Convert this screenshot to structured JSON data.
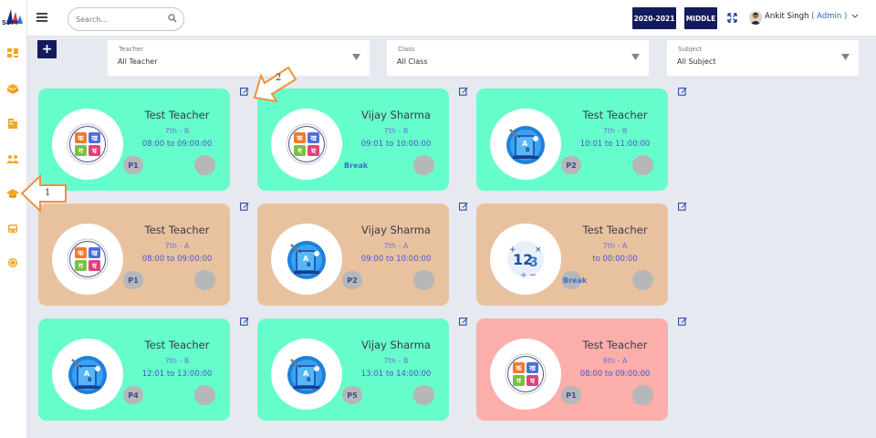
{
  "logo": {
    "text": "SSM"
  },
  "sidebar": {
    "items": [
      {
        "icon": "dashboard-icon",
        "color": "#f5a623"
      },
      {
        "icon": "box-icon",
        "color": "#f5a623"
      },
      {
        "icon": "building-icon",
        "color": "#f5a623"
      },
      {
        "icon": "users-icon",
        "color": "#f5a623"
      },
      {
        "icon": "graduation-cap-icon",
        "color": "#f5a623"
      },
      {
        "icon": "bus-icon",
        "color": "#f5a623"
      },
      {
        "icon": "coin-icon",
        "color": "#f5a623"
      }
    ]
  },
  "header": {
    "search_placeholder": "Search...",
    "session": "2020-2021",
    "level": "MIDDLE",
    "user_name": "Ankit Singh",
    "user_role": "( Admin )"
  },
  "toolbar": {
    "add_label": "+"
  },
  "filters": [
    {
      "label": "Teacher",
      "value": "All Teacher"
    },
    {
      "label": "Class",
      "value": "All Class"
    },
    {
      "label": "Subject",
      "value": "Subject"
    }
  ],
  "filter_values": {
    "subject": "All Subject"
  },
  "cards": [
    {
      "name": "Test Teacher",
      "class": "7th - B",
      "time": "08:00 to 09:00:00",
      "period": "P1",
      "color": "green",
      "icon": "hindi-letters-icon"
    },
    {
      "name": "Vijay Sharma",
      "class": "7th - B",
      "time": "09:01 to 10:00:00",
      "period": "Break",
      "color": "green",
      "icon": "hindi-letters-icon"
    },
    {
      "name": "Test Teacher",
      "class": "7th - B",
      "time": "10:01 to 11:00:00",
      "period": "P2",
      "color": "green",
      "icon": "abc-book-icon"
    },
    {
      "name": "Test Teacher",
      "class": "7th - A",
      "time": "08:00 to 09:00:00",
      "period": "P1",
      "color": "tan",
      "icon": "hindi-letters-icon"
    },
    {
      "name": "Vijay Sharma",
      "class": "7th - A",
      "time": "09:00 to 10:00:00",
      "period": "P2",
      "color": "tan",
      "icon": "abc-book-icon"
    },
    {
      "name": "Test Teacher",
      "class": "7th - A",
      "time": "to 00:00:00",
      "period": "Break",
      "color": "tan",
      "icon": "math-icon"
    },
    {
      "name": "Test Teacher",
      "class": "7th - B",
      "time": "12:01 to 13:00:00",
      "period": "P4",
      "color": "green",
      "icon": "abc-book-icon"
    },
    {
      "name": "Vijay Sharma",
      "class": "7th - B",
      "time": "13:01 to 14:00:00",
      "period": "P5",
      "color": "green",
      "icon": "abc-book-icon"
    },
    {
      "name": "Test Teacher",
      "class": "8th - A",
      "time": "08:00 to 09:00:00",
      "period": "P1",
      "color": "pink",
      "icon": "hindi-letters-icon"
    }
  ],
  "annotations": [
    {
      "label": "1"
    },
    {
      "label": "2"
    }
  ],
  "colors": {
    "navy": "#141a5e",
    "green": "#66fdcc",
    "tan": "#e8c29f",
    "pink": "#fbaeaa",
    "accent": "#f5a623"
  }
}
